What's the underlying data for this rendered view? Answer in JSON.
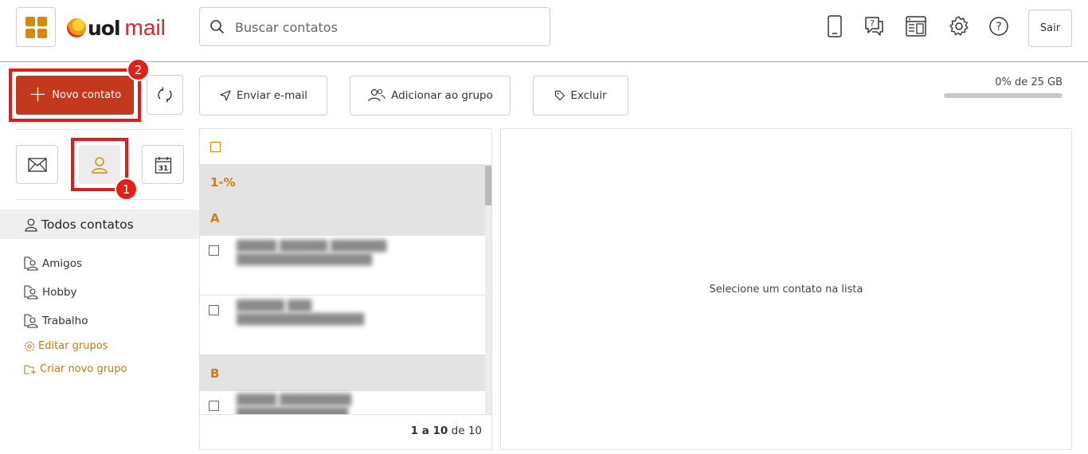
{
  "header": {
    "brand": {
      "uol": "uol",
      "mail": "mail"
    },
    "search": {
      "placeholder": "Buscar contatos"
    },
    "icons": [
      "mobile-icon",
      "help-chat-icon",
      "layout-icon",
      "gear-icon",
      "question-icon"
    ],
    "logout_label": "Sair"
  },
  "toolbar": {
    "new_contact_label": "Novo contato",
    "send_email_label": "Enviar e-mail",
    "add_to_group_label": "Adicionar ao grupo",
    "delete_label": "Excluir",
    "quota": {
      "text": "0% de 25 GB",
      "fraction": 0.0
    }
  },
  "annotations": {
    "badge_1": "1",
    "badge_2": "2"
  },
  "sidebar": {
    "all_contacts": "Todos contatos",
    "groups": [
      {
        "label": "Amigos"
      },
      {
        "label": "Hobby"
      },
      {
        "label": "Trabalho"
      }
    ],
    "edit_groups": "Editar grupos",
    "create_group": "Criar novo grupo"
  },
  "contact_list": {
    "sections": [
      {
        "letter": "1-%"
      },
      {
        "letter": "A"
      },
      {
        "letter": "B"
      }
    ],
    "pagination": {
      "range": "1 a 10",
      "of": "de",
      "total": "10"
    }
  },
  "detail": {
    "empty_message": "Selecione um contato na lista"
  }
}
